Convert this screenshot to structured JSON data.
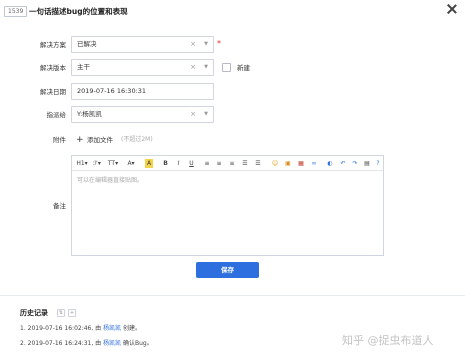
{
  "header": {
    "bug_id": "1539",
    "title": "一句话描述bug的位置和表现"
  },
  "form": {
    "resolution": {
      "label": "解决方案",
      "value": "已解决"
    },
    "build": {
      "label": "解决版本",
      "value": "主干",
      "new_label": "新建"
    },
    "date": {
      "label": "解决日期",
      "value": "2019-07-16 16:30:31"
    },
    "assign": {
      "label": "指派给",
      "value": "Y:杨凯凯"
    },
    "attach": {
      "label": "附件",
      "add_label": "添加文件",
      "hint": "(不超过2M)"
    },
    "comment": {
      "label": "备注",
      "placeholder": "可以在编辑器直接贴图。"
    }
  },
  "toolbar": {
    "items": [
      {
        "name": "heading-button",
        "icon": "H1"
      },
      {
        "name": "font-family-button",
        "icon": "ℱ"
      },
      {
        "name": "font-size-button",
        "icon": "T"
      },
      {
        "name": "font-color-button",
        "icon": "A"
      },
      {
        "name": "highlight-button",
        "icon": "A"
      },
      {
        "name": "bold-button",
        "icon": "B"
      },
      {
        "name": "italic-button",
        "icon": "I"
      },
      {
        "name": "underline-button",
        "icon": "U"
      }
    ]
  },
  "save_label": "保存",
  "history": {
    "title": "历史记录",
    "entries": [
      {
        "prefix": "1. 2019-07-16 16:02:46, 由 ",
        "who": "杨凯凯",
        "action": " 创建。"
      },
      {
        "prefix": "2. 2019-07-16 16:24:31, 由 ",
        "who": "杨凯凯",
        "action": " 确认Bug。"
      }
    ]
  },
  "watermark": "知乎 @捉虫布道人"
}
